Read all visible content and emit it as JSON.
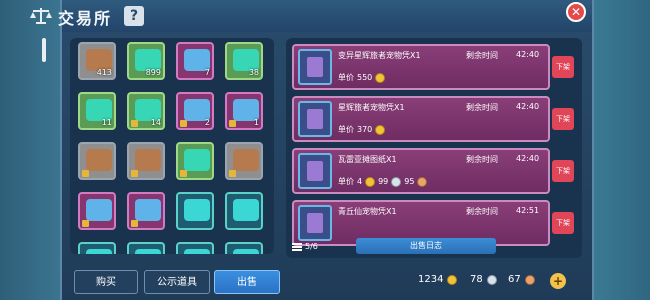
{
  "header": {
    "title": "交易所",
    "help_label": "?",
    "close_label": "✕"
  },
  "inventory": {
    "slots": [
      {
        "icon": "wood-log-icon",
        "count": "413",
        "rarity": "gray"
      },
      {
        "icon": "green-crystal-icon",
        "count": "899",
        "rarity": "green"
      },
      {
        "icon": "blade-icon",
        "count": "7",
        "rarity": "purple"
      },
      {
        "icon": "antler-icon",
        "count": "38",
        "rarity": "green"
      },
      {
        "icon": "food-plate-icon",
        "count": "11",
        "rarity": "green"
      },
      {
        "icon": "tea-cup-icon",
        "count": "14",
        "rarity": "green"
      },
      {
        "icon": "figurine-icon",
        "count": "2",
        "rarity": "purple"
      },
      {
        "icon": "spellbook-icon",
        "count": "1",
        "rarity": "purple"
      },
      {
        "icon": "scroll-icon",
        "count": "",
        "rarity": "gray"
      },
      {
        "icon": "crate-icon",
        "count": "",
        "rarity": "gray"
      },
      {
        "icon": "beetle-icon",
        "count": "",
        "rarity": "green"
      },
      {
        "icon": "car-icon",
        "count": "",
        "rarity": "gray"
      },
      {
        "icon": "car-blue-icon",
        "count": "",
        "rarity": "purple"
      },
      {
        "icon": "mech-icon",
        "count": "",
        "rarity": "purple"
      },
      {
        "icon": "portal-icon",
        "count": "",
        "rarity": "teal"
      },
      {
        "icon": "portal-icon",
        "count": "",
        "rarity": "teal"
      },
      {
        "icon": "portal-icon",
        "count": "",
        "rarity": "teal"
      },
      {
        "icon": "portal-icon",
        "count": "",
        "rarity": "teal"
      },
      {
        "icon": "portal-icon",
        "count": "",
        "rarity": "teal"
      },
      {
        "icon": "portal-icon",
        "count": "",
        "rarity": "teal"
      }
    ]
  },
  "listings": [
    {
      "name": "变异星辉旅者宠物凭X1",
      "time_label": "剩余时间",
      "time": "42:40",
      "price_label": "单价",
      "gold": "550",
      "silver": "",
      "copper": "",
      "remove": "下架"
    },
    {
      "name": "星辉旅者宠物凭X1",
      "time_label": "剩余时间",
      "time": "42:40",
      "price_label": "单价",
      "gold": "370",
      "silver": "",
      "copper": "",
      "remove": "下架"
    },
    {
      "name": "瓦雷亚摊图纸X1",
      "time_label": "剩余时间",
      "time": "42:40",
      "price_label": "单价",
      "gold": "4",
      "silver": "99",
      "copper": "95",
      "remove": "下架"
    },
    {
      "name": "青丘仙宠物凭X1",
      "time_label": "剩余时间",
      "time": "42:51",
      "price_label": "",
      "gold": "",
      "silver": "",
      "copper": "",
      "remove": "下架"
    }
  ],
  "footer": {
    "slots_count": "5/6",
    "log_button": "出售日志"
  },
  "tabs": {
    "buy": "购买",
    "public": "公示道具",
    "sell": "出售"
  },
  "currency": {
    "gold": "1234",
    "diamond": "78",
    "silver": "67"
  },
  "colors": {
    "accent_red": "#e04558",
    "card_purple": "#8a3e78",
    "active_tab": "#3b8fe0"
  }
}
